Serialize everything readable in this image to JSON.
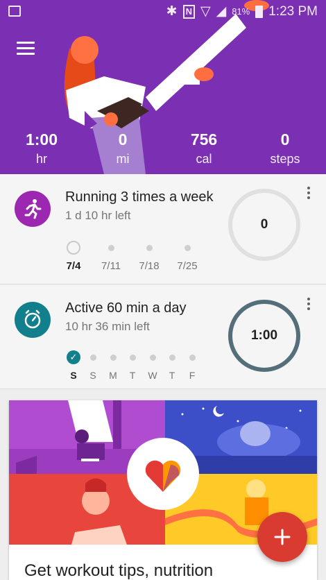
{
  "status_bar": {
    "battery": "81%",
    "time": "1:23 PM"
  },
  "header": {
    "menu_icon": "hamburger-menu-icon",
    "stats": [
      {
        "value": "1:00",
        "unit": "hr"
      },
      {
        "value": "0",
        "unit": "mi"
      },
      {
        "value": "756",
        "unit": "cal"
      },
      {
        "value": "0",
        "unit": "steps"
      }
    ]
  },
  "goals": [
    {
      "icon": "running-icon",
      "icon_color": "#9c27b0",
      "title": "Running 3 times a week",
      "subtitle": "1 d 10 hr left",
      "progress_value": "0",
      "progress_fraction": 0,
      "weeks": [
        "7/4",
        "7/11",
        "7/18",
        "7/25"
      ]
    },
    {
      "icon": "timer-icon",
      "icon_color": "#12808c",
      "title": "Active 60 min a day",
      "subtitle": "10 hr 36 min left",
      "progress_value": "1:00",
      "progress_fraction": 1,
      "days": [
        "S",
        "S",
        "M",
        "T",
        "W",
        "T",
        "F"
      ]
    }
  ],
  "promo": {
    "logo_icon": "google-fit-heart-icon",
    "text": "Get workout tips, nutrition"
  },
  "fab": {
    "icon": "plus-icon"
  },
  "colors": {
    "header_bg": "#7b2fb3",
    "accent_purple": "#9c27b0",
    "accent_teal": "#12808c",
    "ring_complete": "#546e7a",
    "fab": "#d93b30"
  }
}
